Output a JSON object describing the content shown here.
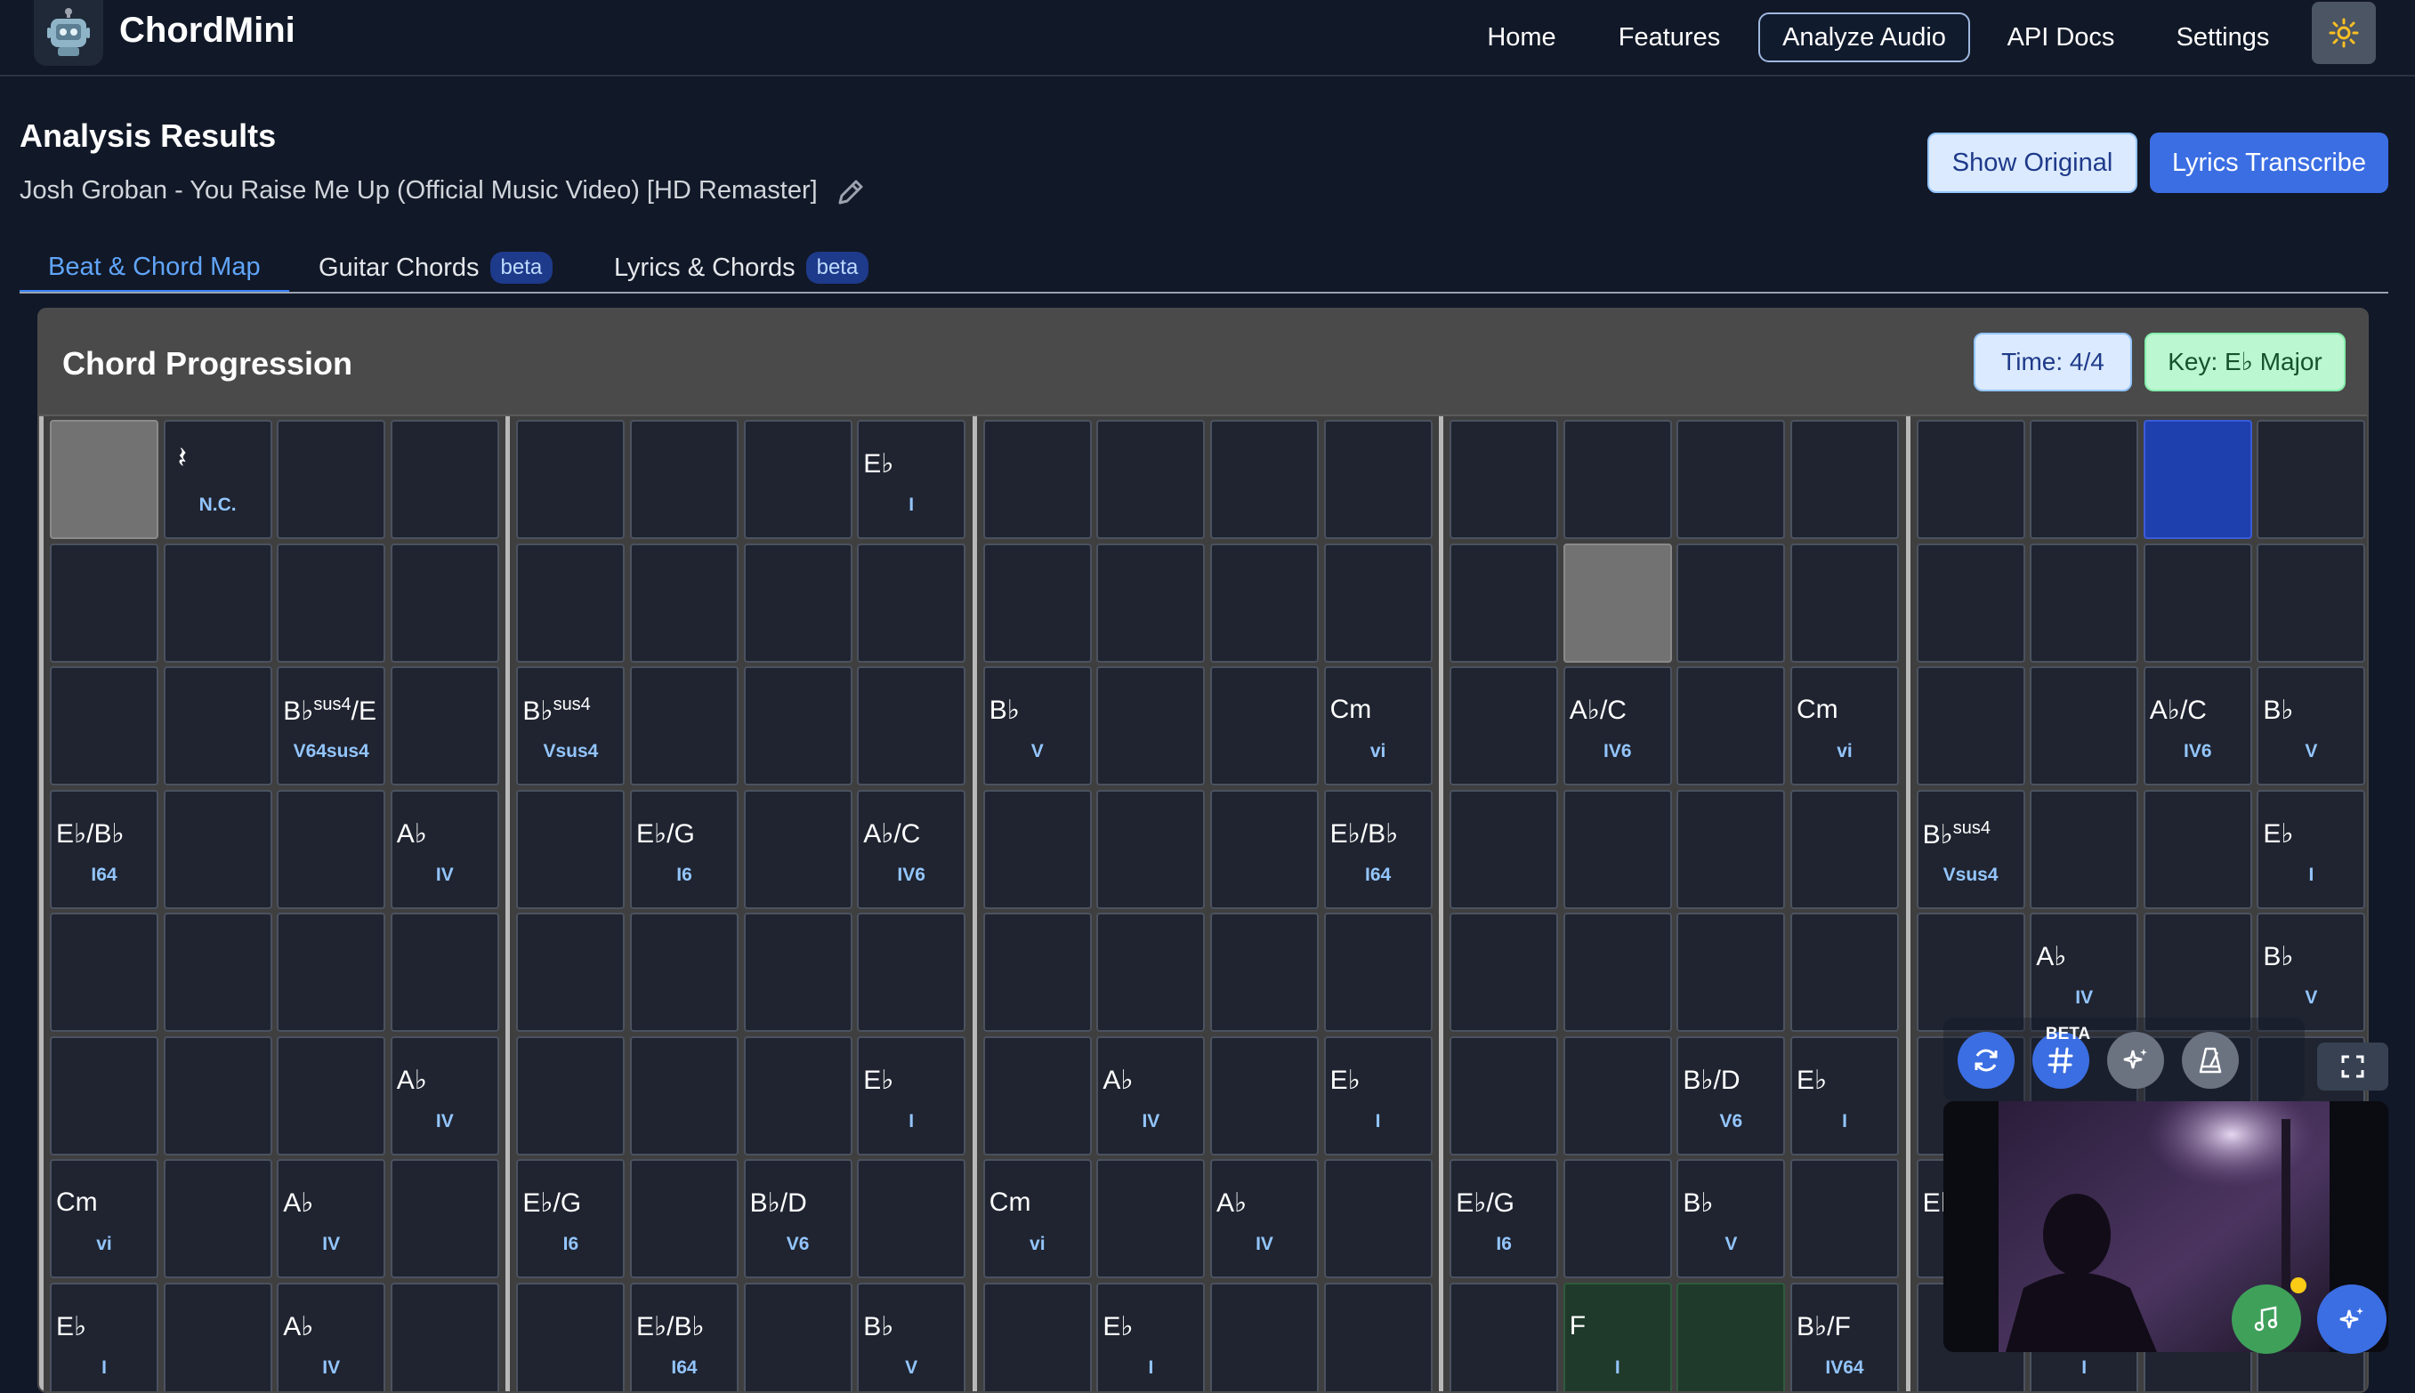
{
  "app": {
    "name": "ChordMini"
  },
  "nav": {
    "items": [
      "Home",
      "Features",
      "Analyze Audio",
      "API Docs",
      "Settings"
    ],
    "active": "Analyze Audio"
  },
  "header": {
    "title": "Analysis Results",
    "song": "Josh Groban - You Raise Me Up (Official Music Video) [HD Remaster]",
    "show_original": "Show Original",
    "lyrics_transcribe": "Lyrics Transcribe"
  },
  "tabs": [
    {
      "label": "Beat & Chord Map",
      "badge": ""
    },
    {
      "label": "Guitar Chords",
      "badge": "beta"
    },
    {
      "label": "Lyrics & Chords",
      "badge": "beta"
    }
  ],
  "panel": {
    "title": "Chord Progression",
    "time": "Time: 4/4",
    "key": "Key: E♭ Major"
  },
  "controls": {
    "beta_label": "BETA"
  },
  "colors": {
    "accent": "#3b6ee3",
    "highlight_blue": "#1e40af",
    "chord_roman": "#93c5fd",
    "current_green": "#1f3a2a"
  },
  "grid": [
    [
      {
        "s": "gray"
      },
      {
        "rest": true,
        "r": "N.C."
      },
      {},
      {},
      {},
      {},
      {},
      {
        "c": "E♭",
        "r": "I"
      },
      {},
      {},
      {},
      {},
      {},
      {},
      {},
      {},
      {},
      {},
      {
        "s": "blue"
      },
      {}
    ],
    [
      {},
      {},
      {},
      {},
      {},
      {},
      {},
      {},
      {},
      {},
      {},
      {},
      {},
      {
        "s": "gray"
      },
      {},
      {},
      {},
      {},
      {},
      {}
    ],
    [
      {},
      {},
      {
        "c": "B♭",
        "sup": "sus4",
        "c2": "/E",
        "r": "V64sus4"
      },
      {},
      {
        "c": "B♭",
        "sup": "sus4",
        "r": "Vsus4"
      },
      {},
      {},
      {},
      {
        "c": "B♭",
        "r": "V"
      },
      {},
      {},
      {
        "c": "Cm",
        "r": "vi"
      },
      {},
      {
        "c": "A♭/C",
        "r": "IV6"
      },
      {},
      {
        "c": "Cm",
        "r": "vi"
      },
      {},
      {},
      {
        "c": "A♭/C",
        "r": "IV6"
      },
      {
        "c": "B♭",
        "r": "V"
      }
    ],
    [
      {
        "c": "E♭/B♭",
        "r": "I64"
      },
      {},
      {},
      {
        "c": "A♭",
        "r": "IV"
      },
      {},
      {
        "c": "E♭/G",
        "r": "I6"
      },
      {},
      {
        "c": "A♭/C",
        "r": "IV6"
      },
      {},
      {},
      {},
      {
        "c": "E♭/B♭",
        "r": "I64"
      },
      {},
      {},
      {},
      {},
      {
        "c": "B♭",
        "sup": "sus4",
        "r": "Vsus4"
      },
      {},
      {},
      {
        "c": "E♭",
        "r": "I"
      }
    ],
    [
      {},
      {},
      {},
      {},
      {},
      {},
      {},
      {},
      {},
      {},
      {},
      {},
      {},
      {},
      {},
      {},
      {},
      {
        "c": "A♭",
        "r": "IV"
      },
      {},
      {
        "c": "B♭",
        "r": "V"
      }
    ],
    [
      {},
      {},
      {},
      {
        "c": "A♭",
        "r": "IV"
      },
      {},
      {},
      {},
      {
        "c": "E♭",
        "r": "I"
      },
      {},
      {
        "c": "A♭",
        "r": "IV"
      },
      {},
      {
        "c": "E♭",
        "r": "I"
      },
      {},
      {},
      {
        "c": "B♭/D",
        "r": "V6"
      },
      {
        "c": "E♭",
        "r": "I"
      },
      {},
      {},
      {},
      {}
    ],
    [
      {
        "c": "Cm",
        "r": "vi"
      },
      {},
      {
        "c": "A♭",
        "r": "IV"
      },
      {},
      {
        "c": "E♭/G",
        "r": "I6"
      },
      {},
      {
        "c": "B♭/D",
        "r": "V6"
      },
      {},
      {
        "c": "Cm",
        "r": "vi"
      },
      {},
      {
        "c": "A♭",
        "r": "IV"
      },
      {},
      {
        "c": "E♭/G",
        "r": "I6"
      },
      {},
      {
        "c": "B♭",
        "r": "V"
      },
      {},
      {
        "c": "E♭",
        "r": ""
      },
      {},
      {},
      {}
    ],
    [
      {
        "c": "E♭",
        "r": "I"
      },
      {},
      {
        "c": "A♭",
        "r": "IV"
      },
      {},
      {},
      {
        "c": "E♭/B♭",
        "r": "I64"
      },
      {},
      {
        "c": "B♭",
        "r": "V"
      },
      {},
      {
        "c": "E♭",
        "r": "I"
      },
      {},
      {},
      {},
      {
        "c": "F",
        "r": "I",
        "s": "green"
      },
      {
        "s": "green"
      },
      {
        "c": "B♭/F",
        "r": "IV64"
      },
      {},
      {
        "r": "I"
      },
      {},
      {}
    ]
  ]
}
